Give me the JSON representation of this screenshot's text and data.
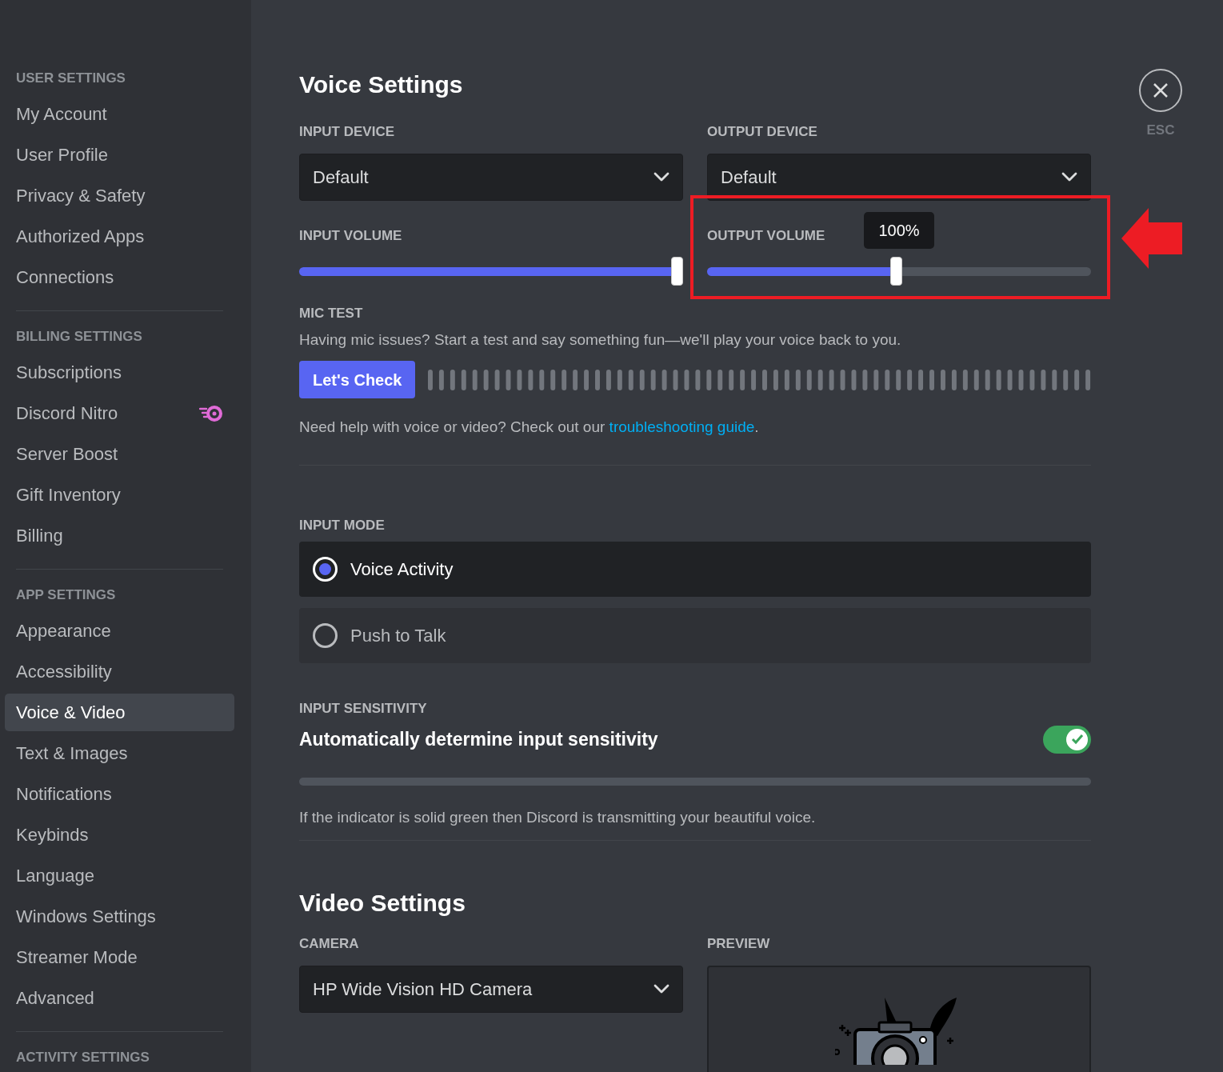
{
  "sidebar": {
    "sections": [
      {
        "heading": "USER SETTINGS",
        "items": [
          {
            "label": "My Account",
            "selected": false,
            "kind": "plain"
          },
          {
            "label": "User Profile",
            "selected": false,
            "kind": "plain"
          },
          {
            "label": "Privacy & Safety",
            "selected": false,
            "kind": "plain"
          },
          {
            "label": "Authorized Apps",
            "selected": false,
            "kind": "plain"
          },
          {
            "label": "Connections",
            "selected": false,
            "kind": "plain"
          }
        ]
      },
      {
        "heading": "BILLING SETTINGS",
        "items": [
          {
            "label": "Subscriptions",
            "selected": false,
            "kind": "plain"
          },
          {
            "label": "Discord Nitro",
            "selected": false,
            "kind": "nitro"
          },
          {
            "label": "Server Boost",
            "selected": false,
            "kind": "plain"
          },
          {
            "label": "Gift Inventory",
            "selected": false,
            "kind": "plain"
          },
          {
            "label": "Billing",
            "selected": false,
            "kind": "plain"
          }
        ]
      },
      {
        "heading": "APP SETTINGS",
        "items": [
          {
            "label": "Appearance",
            "selected": false,
            "kind": "plain"
          },
          {
            "label": "Accessibility",
            "selected": false,
            "kind": "plain"
          },
          {
            "label": "Voice & Video",
            "selected": true,
            "kind": "plain"
          },
          {
            "label": "Text & Images",
            "selected": false,
            "kind": "plain"
          },
          {
            "label": "Notifications",
            "selected": false,
            "kind": "plain"
          },
          {
            "label": "Keybinds",
            "selected": false,
            "kind": "plain"
          },
          {
            "label": "Language",
            "selected": false,
            "kind": "plain"
          },
          {
            "label": "Windows Settings",
            "selected": false,
            "kind": "plain"
          },
          {
            "label": "Streamer Mode",
            "selected": false,
            "kind": "plain"
          },
          {
            "label": "Advanced",
            "selected": false,
            "kind": "plain"
          }
        ]
      },
      {
        "heading": "ACTIVITY SETTINGS"
      }
    ]
  },
  "close": {
    "label": "ESC"
  },
  "voice_settings": {
    "title": "Voice Settings",
    "input_device": {
      "label": "INPUT DEVICE",
      "value": "Default"
    },
    "output_device": {
      "label": "OUTPUT DEVICE",
      "value": "Default"
    },
    "input_volume": {
      "label": "INPUT VOLUME",
      "level": 1.0
    },
    "output_volume": {
      "label": "OUTPUT VOLUME",
      "level": 0.5,
      "tooltip": "100%",
      "highlighted": true
    },
    "mic_test": {
      "label": "MIC TEST",
      "description": "Having mic issues? Start a test and say something fun—we'll play your voice back to you.",
      "button": "Let's Check"
    },
    "help": {
      "text": "Need help with voice or video? Check out our ",
      "link": "troubleshooting guide",
      "after": "."
    },
    "input_mode": {
      "label": "INPUT MODE",
      "options": [
        {
          "label": "Voice Activity",
          "selected": true
        },
        {
          "label": "Push to Talk",
          "selected": false
        }
      ]
    },
    "input_sensitivity": {
      "label": "INPUT SENSITIVITY",
      "toggle_label": "Automatically determine input sensitivity",
      "on": true,
      "note": "If the indicator is solid green then Discord is transmitting your beautiful voice."
    }
  },
  "video_settings": {
    "title": "Video Settings",
    "camera": {
      "label": "CAMERA",
      "value": "HP Wide Vision HD Camera"
    },
    "preview": {
      "label": "PREVIEW"
    }
  }
}
